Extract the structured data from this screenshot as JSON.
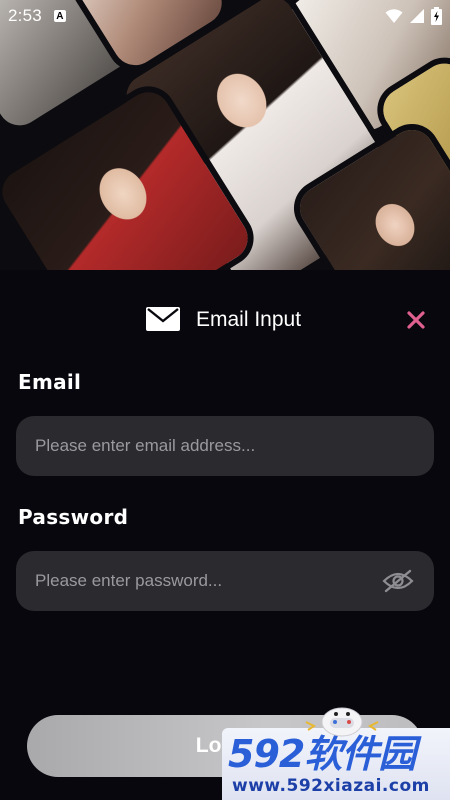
{
  "status_bar": {
    "time": "2:53",
    "notification_badge": "A",
    "icons": [
      "wifi-icon",
      "signal-icon",
      "battery-icon"
    ]
  },
  "sheet": {
    "title": "Email Input",
    "icon": "envelope-icon",
    "close_icon": "close-icon",
    "close_color": "#e0608f"
  },
  "form": {
    "email_label": "Email",
    "email_placeholder": "Please enter email address...",
    "email_value": "",
    "password_label": "Password",
    "password_placeholder": "Please enter password...",
    "password_value": "",
    "password_toggle_icon": "eye-off-icon"
  },
  "login": {
    "label": "Log"
  },
  "watermark": {
    "main": "592软件园",
    "sub": "www.592xiazai.com"
  }
}
